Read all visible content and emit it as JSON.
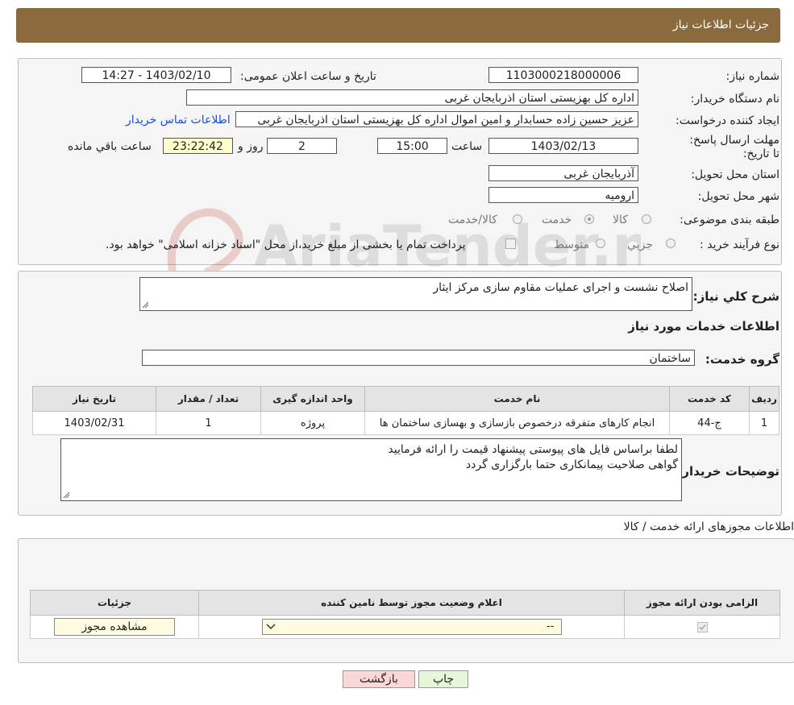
{
  "header": {
    "title": "جزئیات اطلاعات نیاز"
  },
  "form": {
    "need_number_label": "شماره نیاز:",
    "need_number": "1103000218000006",
    "announce_label": "تاریخ و ساعت اعلان عمومی:",
    "announce_value": "1403/02/10 - 14:27",
    "buyer_org_label": "نام دستگاه خریدار:",
    "buyer_org": "اداره کل بهزیستی استان اذربایجان غربی",
    "creator_label": "ایجاد کننده درخواست:",
    "creator": "عزیز حسین زاده حسابدار و امین اموال اداره کل بهزیستی استان اذربایجان غربی",
    "contact_link": "اطلاعات تماس خریدار",
    "deadline_label": "مهلت ارسال پاسخ: تا تاریخ:",
    "deadline_date": "1403/02/13",
    "time_label": "ساعت",
    "deadline_time": "15:00",
    "days": "2",
    "days_label": "روز و",
    "remaining": "23:22:42",
    "remaining_label": "ساعت باقي مانده",
    "province_label": "استان محل تحویل:",
    "province": "آذربایجان غربی",
    "city_label": "شهر محل تحویل:",
    "city": "ارومیه",
    "category_label": "طبقه بندی موضوعی:",
    "category_options": [
      "کالا",
      "خدمت",
      "کالا/خدمت"
    ],
    "process_label": "نوع فرآیند خرید :",
    "process_options": [
      "جزیي",
      "متوسط"
    ],
    "payment_note": "پرداخت تمام یا بخشی از مبلغ خرید،از محل \"اسناد خزانه اسلامی\" خواهد بود."
  },
  "summary": {
    "label": "شرح کلي نياز:",
    "value": "اصلاح نشست و اجرای عملیات مقاوم سازی مرکز ایثار"
  },
  "services": {
    "section_title": "اطلاعات خدمات مورد نیاز",
    "group_label": "گروه خدمت:",
    "group_value": "ساختمان",
    "table": {
      "headers": [
        "ردیف",
        "کد خدمت",
        "نام خدمت",
        "واحد اندازه گیری",
        "تعداد / مقدار",
        "تاریخ نیاز"
      ],
      "rows": [
        [
          "1",
          "ج-44",
          "انجام کارهای متفرقه درخصوص بازسازی و بهسازی ساختمان ها",
          "پروژه",
          "1",
          "1403/02/31"
        ]
      ]
    }
  },
  "notes": {
    "label": "توضیحات خریدار:",
    "line1": "لطفا براساس فایل های پیوستی پیشنهاد قیمت را ارائه فرمایید",
    "line2": "گواهی صلاحیت پیمانکاری حتما بارگزاری گردد"
  },
  "permits": {
    "section_title": "اطلاعات مجوزهای ارائه خدمت / کالا",
    "headers": [
      "الزامی بودن ارائه مجوز",
      "اعلام وضعیت مجوز توسط نامین کننده",
      "جزئیات"
    ],
    "select_value": "--",
    "view_button": "مشاهده مجوز"
  },
  "buttons": {
    "back": "بازگشت",
    "print": "چاپ"
  },
  "watermark": "AriaTender.neT",
  "colors": {
    "header_bg": "#8b6b3d",
    "link": "#1a4fd8",
    "back_btn": "#fbd7d7",
    "print_btn": "#e6f7d9"
  }
}
